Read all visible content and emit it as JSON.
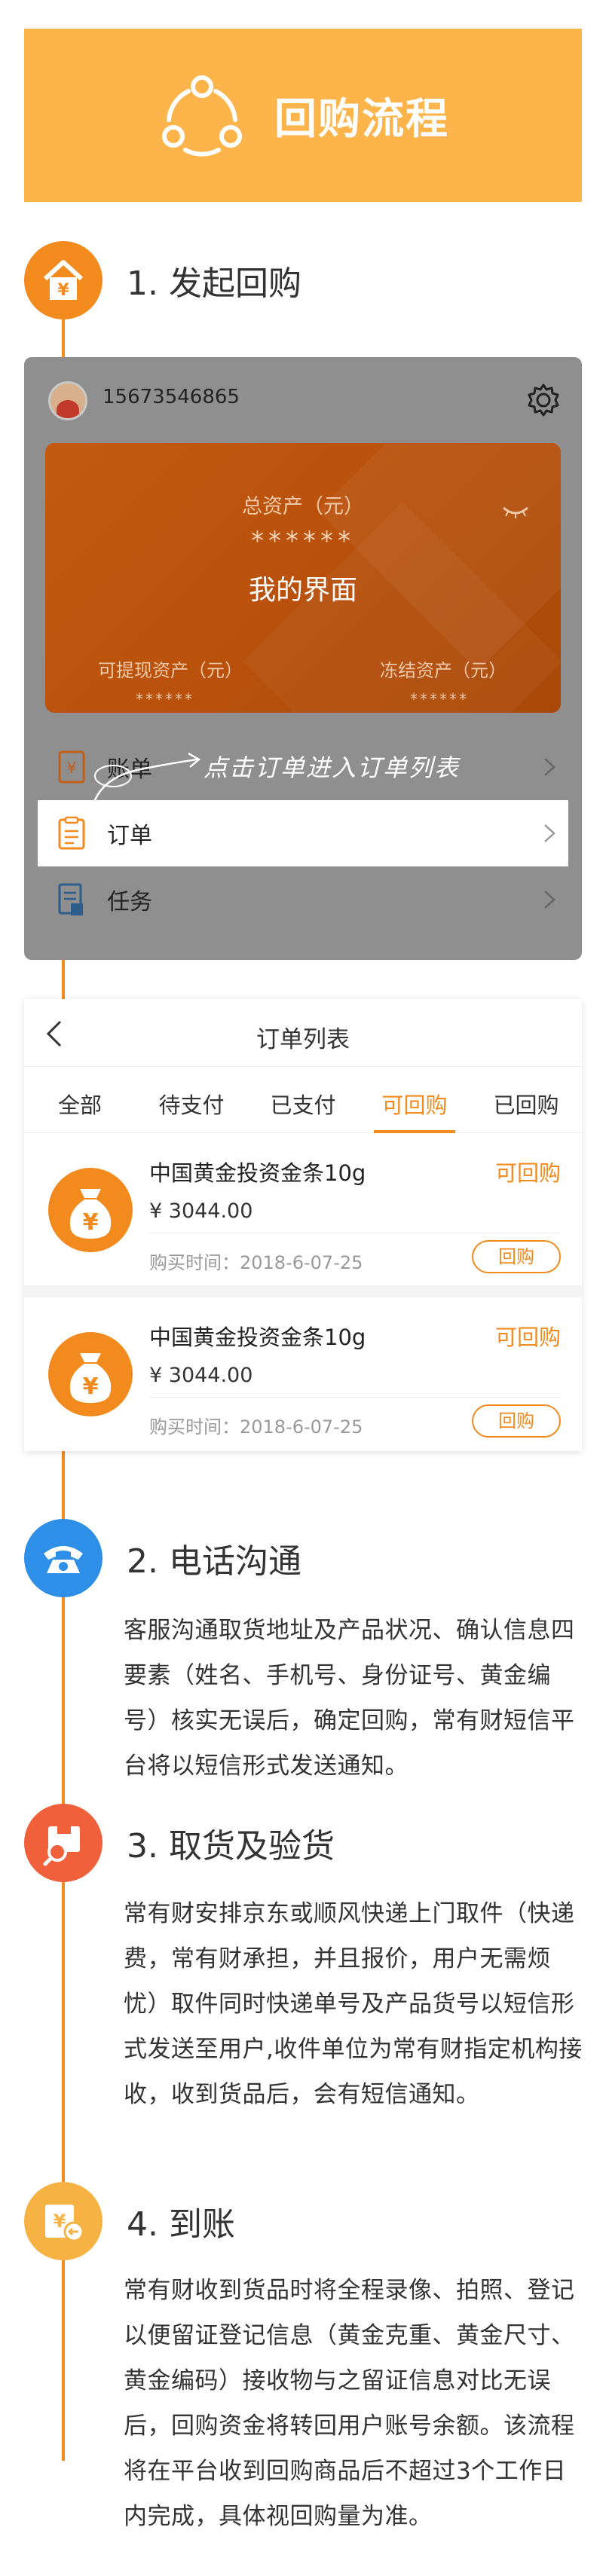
{
  "header": {
    "title": "回购流程"
  },
  "steps": {
    "s1": {
      "title": "1. 发起回购"
    },
    "s2": {
      "title": "2. 电话沟通",
      "text": "客服沟通取货地址及产品状况、确认信息四要素（姓名、手机号、身份证号、黄金编号）核实无误后，确定回购，常有财短信平台将以短信形式发送通知。"
    },
    "s3": {
      "title": "3. 取货及验货",
      "text": "常有财安排京东或顺风快递上门取件（快递费，常有财承担，并且报价，用户无需烦忧）取件同时快递单号及产品货号以短信形式发送至用户,收件单位为常有财指定机构接收，收到货品后，会有短信通知。"
    },
    "s4": {
      "title": "4. 到账",
      "text": "常有财收到货品时将全程录像、拍照、登记以便留证登记信息（黄金克重、黄金尺寸、黄金编码）接收物与之留证信息对比无误后，回购资金将转回用户账号余额。该流程将在平台收到回购商品后不超过3个工作日内完成，具体视回购量为准。"
    }
  },
  "my_page": {
    "phone": "15673546865",
    "total_assets_label": "总资产（元）",
    "total_assets_value": "******",
    "overlay_title": "我的界面",
    "withdrawable_label": "可提现资产（元）",
    "withdrawable_value": "******",
    "frozen_label": "冻结资产（元）",
    "frozen_value": "******",
    "rows": [
      {
        "label": "账单",
        "icon": "bill-icon"
      },
      {
        "label": "订单",
        "icon": "order-icon"
      },
      {
        "label": "任务",
        "icon": "task-icon"
      }
    ],
    "annotation": "点击订单进入订单列表"
  },
  "order_list": {
    "title": "订单列表",
    "tabs": [
      "全部",
      "待支付",
      "已支付",
      "可回购",
      "已回购"
    ],
    "selected_tab": "可回购",
    "items": [
      {
        "name": "中国黄金投资金条10g",
        "price": "¥ 3044.00",
        "date": "购买时间：2018-6-07-25",
        "status": "可回购",
        "button": "回购"
      },
      {
        "name": "中国黄金投资金条10g",
        "price": "¥ 3044.00",
        "date": "购买时间：2018-6-07-25",
        "status": "可回购",
        "button": "回购"
      }
    ]
  },
  "colors": {
    "accent": "#f28a1e",
    "banner": "#fdb44b",
    "phone_step": "#2e8fe8",
    "pickup_step": "#f0603a",
    "payout_step": "#f6b243"
  }
}
